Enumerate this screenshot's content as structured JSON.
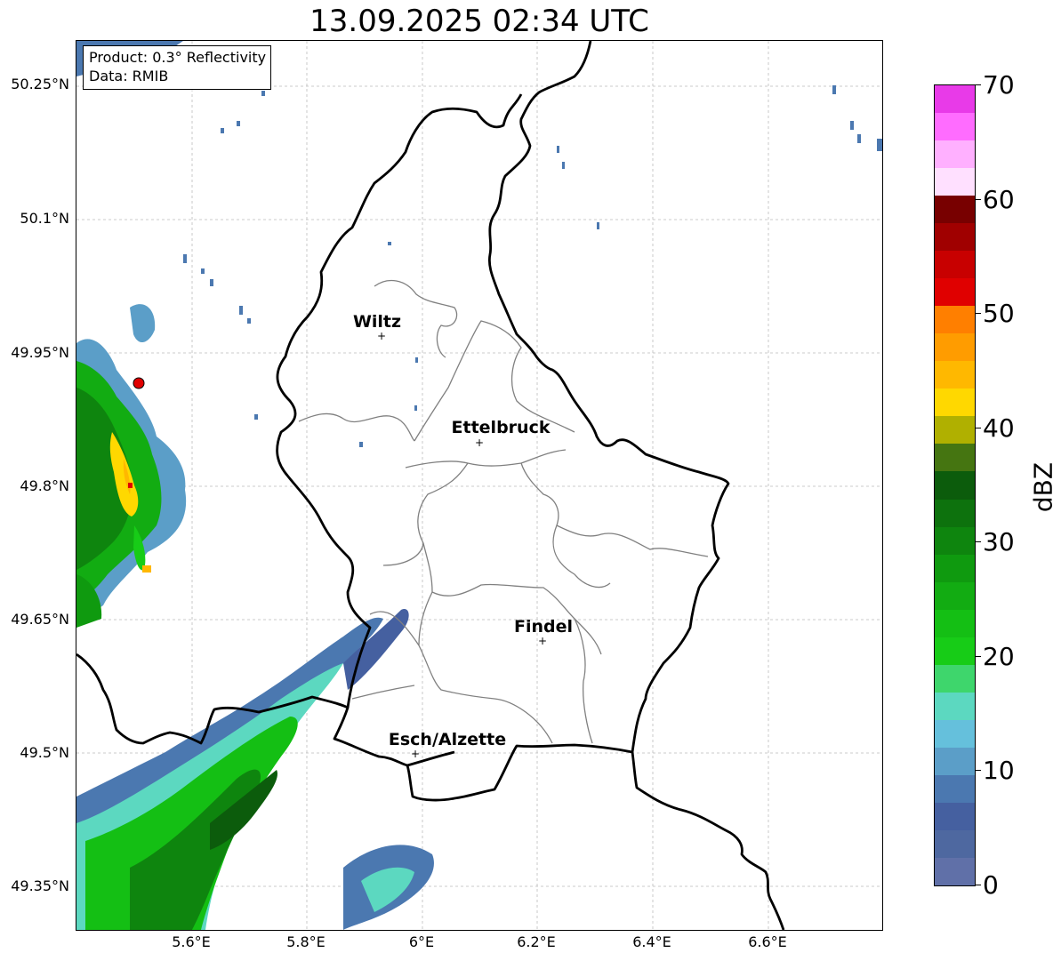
{
  "title": "13.09.2025 02:34 UTC",
  "info": {
    "product": "Product: 0.3° Reflectivity",
    "data": "Data: RMIB"
  },
  "axes": {
    "lat_labels": [
      "50.25°N",
      "50.1°N",
      "49.95°N",
      "49.8°N",
      "49.65°N",
      "49.5°N",
      "49.35°N"
    ],
    "lon_labels": [
      "5.6°E",
      "5.8°E",
      "6°E",
      "6.2°E",
      "6.4°E",
      "6.6°E"
    ]
  },
  "cities": [
    {
      "name": "Wiltz"
    },
    {
      "name": "Ettelbruck"
    },
    {
      "name": "Findel"
    },
    {
      "name": "Esch/Alzette"
    }
  ],
  "colorbar": {
    "unit": "dBZ",
    "tick_labels": [
      "70",
      "60",
      "50",
      "40",
      "30",
      "20",
      "10",
      "0"
    ],
    "colors": [
      "#e83ae8",
      "#ff6cff",
      "#ffb0ff",
      "#ffe0ff",
      "#780000",
      "#a00000",
      "#c80000",
      "#e00000",
      "#ff7f00",
      "#ff9c00",
      "#ffb800",
      "#ffd800",
      "#b0b000",
      "#457511",
      "#0c5c0c",
      "#0d720d",
      "#0e850e",
      "#0f9a0f",
      "#12ac12",
      "#14bf14",
      "#17cc17",
      "#3ed66c",
      "#5cd8c0",
      "#65c0dc",
      "#5b9ec8",
      "#4b78b0",
      "#4560a0",
      "#4e68a0",
      "#6070a8"
    ]
  },
  "colors": {
    "border": "#000000",
    "cantons": "#808080",
    "grid": "#bbbbbb",
    "marker": "#e00000"
  }
}
